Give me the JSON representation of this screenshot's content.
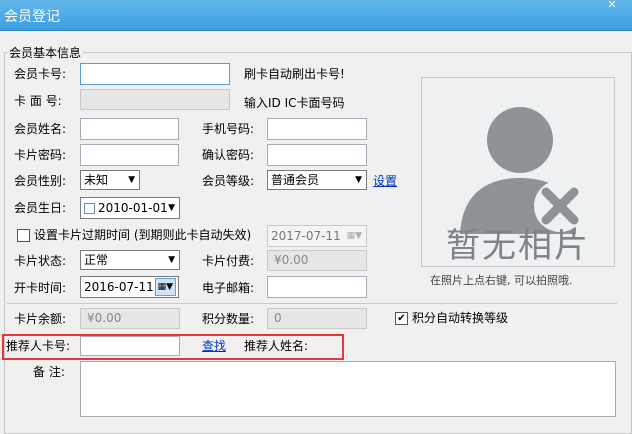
{
  "window": {
    "title": "会员登记",
    "close": "✕"
  },
  "section": {
    "legend": "会员基本信息"
  },
  "form": {
    "card_no_label": "会员卡号:",
    "card_no_value": "",
    "card_no_hint": "刷卡自动刷出卡号!",
    "face_no_label": "卡 面 号:",
    "face_no_hint": "输入ID IC卡面号码",
    "name_label": "会员姓名:",
    "phone_label": "手机号码:",
    "password_label": "卡片密码:",
    "confirm_label": "确认密码:",
    "gender_label": "会员性别:",
    "gender_value": "未知",
    "level_label": "会员等级:",
    "level_value": "普通会员",
    "level_settings": "设置",
    "birthday_label": "会员生日:",
    "birthday_value": "2010-01-01",
    "expiry_checkbox_label": "设置卡片过期时间 (到期则此卡自动失效)",
    "expiry_value": "2017-07-11",
    "status_label": "卡片状态:",
    "status_value": "正常",
    "fee_label": "卡片付费:",
    "fee_value": "¥0.00",
    "open_label": "开卡时间:",
    "open_value": "2016-07-11",
    "email_label": "电子邮箱:",
    "balance_label": "卡片余额:",
    "balance_value": "¥0.00",
    "points_label": "积分数量:",
    "points_value": "0",
    "auto_level_label": "积分自动转换等级",
    "referrer_no_label": "推荐人卡号:",
    "referrer_find": "查找",
    "referrer_name_label": "推荐人姓名:",
    "remark_label": "备  注:"
  },
  "photo": {
    "placeholder": "暂无相片",
    "hint": "在照片上点右键, 可以拍照哦."
  },
  "colors": {
    "title_bar": "#3b9ee0",
    "highlight": "#e8343a",
    "link": "#0033cc"
  }
}
